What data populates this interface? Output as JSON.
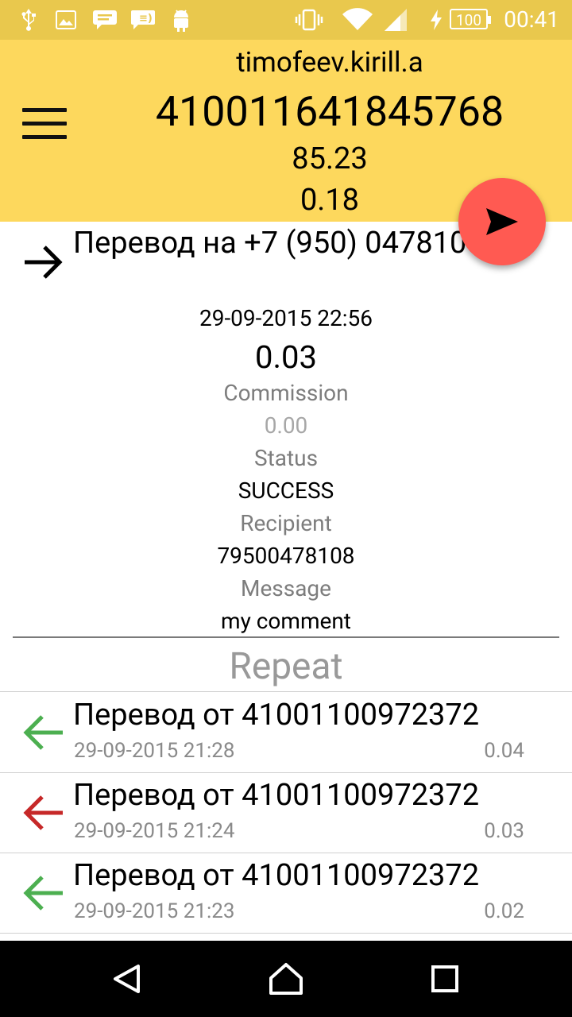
{
  "status_bar": {
    "time": "00:41",
    "battery": "100",
    "icons": [
      "usb-icon",
      "image-icon",
      "chat-icon",
      "message-icon",
      "android-icon",
      "vibrate-icon",
      "wifi-icon",
      "signal-icon",
      "charging-icon"
    ]
  },
  "header": {
    "username": "timofeev.kirill.a",
    "account": "410011641845768",
    "balance": "85.23",
    "secondary_value": "0.18"
  },
  "detail": {
    "title": "Перевод на +7 (950) 0478108",
    "datetime": "29-09-2015 22:56",
    "amount": "0.03",
    "commission_label": "Commission",
    "commission_value": "0.00",
    "status_label": "Status",
    "status_value": "SUCCESS",
    "recipient_label": "Recipient",
    "recipient_value": "79500478108",
    "message_label": "Message",
    "message_value": "my comment",
    "repeat_label": "Repeat"
  },
  "transactions": [
    {
      "title": "Перевод от 41001100972372",
      "date": "29-09-2015 21:28",
      "amount": "0.04",
      "direction_color": "#4caf50"
    },
    {
      "title": "Перевод от 41001100972372",
      "date": "29-09-2015 21:24",
      "amount": "0.03",
      "direction_color": "#c62828"
    },
    {
      "title": "Перевод от 41001100972372",
      "date": "29-09-2015 21:23",
      "amount": "0.02",
      "direction_color": "#4caf50"
    }
  ],
  "colors": {
    "status_bar": "#e9c84d",
    "header": "#fdd85d",
    "fab": "#ff5a52"
  }
}
